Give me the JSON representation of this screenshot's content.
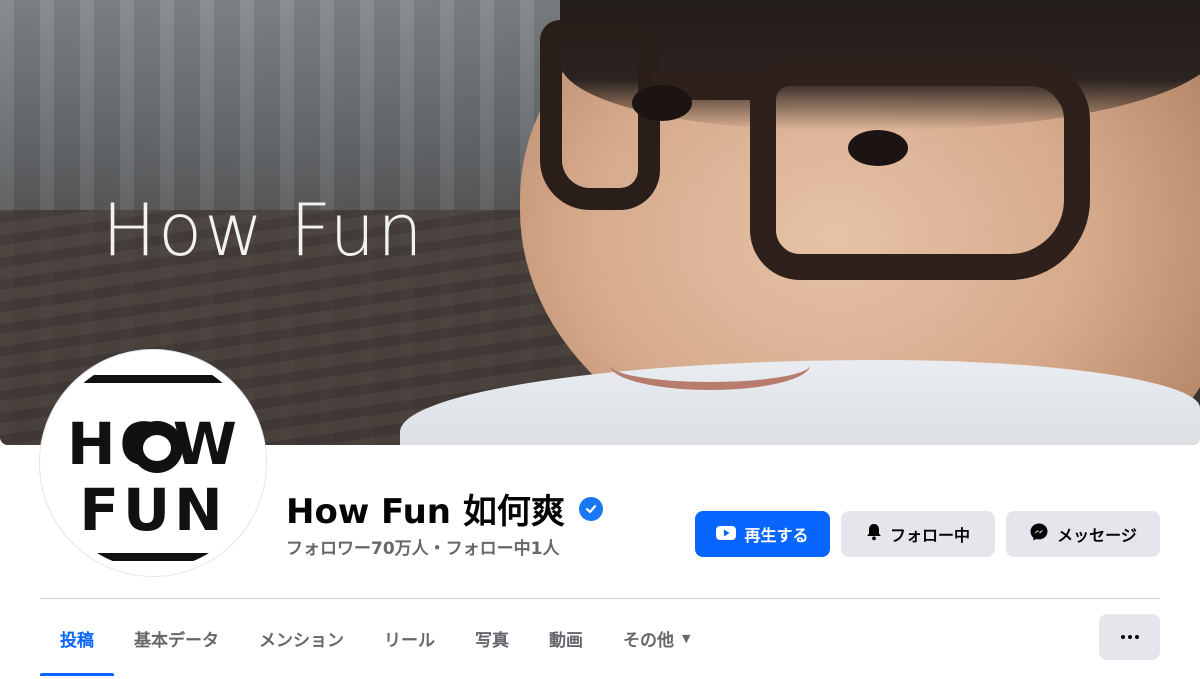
{
  "cover": {
    "title": "How Fun"
  },
  "avatar": {
    "line1": "HOW",
    "line2": "FUN"
  },
  "profile": {
    "name": "How Fun 如何爽",
    "stats": "フォロワー70万人・フォロー中1人"
  },
  "actions": {
    "play_label": "再生する",
    "follow_label": "フォロー中",
    "message_label": "メッセージ"
  },
  "tabs": [
    {
      "label": "投稿",
      "active": true
    },
    {
      "label": "基本データ",
      "active": false
    },
    {
      "label": "メンション",
      "active": false
    },
    {
      "label": "リール",
      "active": false
    },
    {
      "label": "写真",
      "active": false
    },
    {
      "label": "動画",
      "active": false
    },
    {
      "label": "その他",
      "active": false
    }
  ],
  "icons": {
    "play": "youtube-play-icon",
    "follow": "bell-icon",
    "message": "messenger-icon",
    "verified": "verified-badge-icon",
    "more_tab": "caret-down-icon",
    "more_button": "ellipsis-icon"
  },
  "colors": {
    "accent": "#0866ff",
    "verified": "#1877f2",
    "secondary_button": "#e4e6eb",
    "muted_text": "#65676b"
  }
}
